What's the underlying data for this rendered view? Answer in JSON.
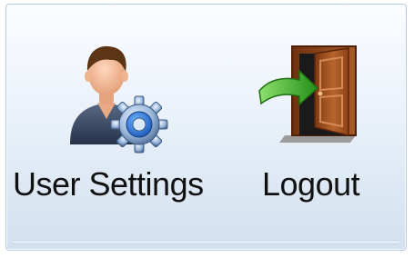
{
  "panel": {
    "actions": [
      {
        "label": "User Settings",
        "icon": "user-settings-icon"
      },
      {
        "label": "Logout",
        "icon": "door-exit-icon"
      }
    ]
  },
  "colors": {
    "panel_top": "#fbfdff",
    "panel_bottom": "#d3e0ef",
    "panel_border": "#b9c9dc",
    "gear_blue": "#2f6fd0",
    "door_brown": "#9b4d20",
    "arrow_green": "#36a61e"
  }
}
